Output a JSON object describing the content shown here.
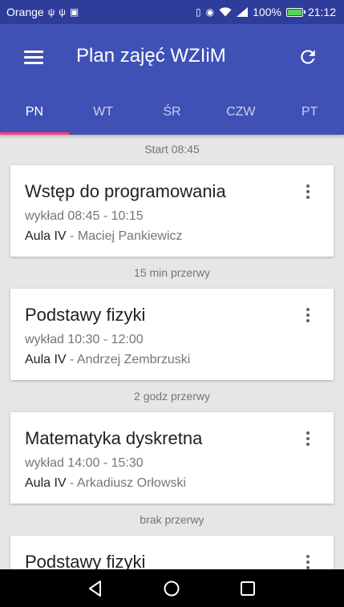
{
  "status_bar": {
    "carrier": "Orange",
    "usb_icon": "usb-icon",
    "notification_icon": "notification-icon",
    "vibrate_icon": "vibrate-icon",
    "eye_icon": "eye-icon",
    "wifi_icon": "wifi-icon",
    "signal_icon": "signal-icon",
    "battery_percent": "100%",
    "battery_icon": "battery-icon",
    "time": "21:12"
  },
  "app_bar": {
    "title": "Plan zajęć WZIiM",
    "menu_icon": "menu-icon",
    "refresh_icon": "refresh-icon"
  },
  "tabs": [
    {
      "label": "PN",
      "active": true
    },
    {
      "label": "WT",
      "active": false
    },
    {
      "label": "ŚR",
      "active": false
    },
    {
      "label": "CZW",
      "active": false
    },
    {
      "label": "PT",
      "active": false
    }
  ],
  "schedule": {
    "start_label": "Start 08:45",
    "items": [
      {
        "title": "Wstęp do programowania",
        "time": "wykład 08:45 - 10:15",
        "room": "Aula IV",
        "lecturer": " - Maciej Pankiewicz",
        "break_after": "15 min przerwy"
      },
      {
        "title": "Podstawy fizyki",
        "time": "wykład 10:30 - 12:00",
        "room": "Aula IV",
        "lecturer": " - Andrzej Zembrzuski",
        "break_after": "2 godz przerwy"
      },
      {
        "title": "Matematyka dyskretna",
        "time": "wykład 14:00 - 15:30",
        "room": "Aula IV",
        "lecturer": " - Arkadiusz Orłowski",
        "break_after": "brak przerwy"
      },
      {
        "title": "Podstawy fizyki"
      }
    ]
  },
  "nav_bar": {
    "back_icon": "back-triangle-icon",
    "home_icon": "home-circle-icon",
    "recents_icon": "recents-square-icon"
  },
  "colors": {
    "status_bar": "#2f3d9a",
    "primary": "#3f51b5",
    "tab_indicator": "#ff4081",
    "background": "#e6e6e6",
    "card": "#ffffff"
  }
}
